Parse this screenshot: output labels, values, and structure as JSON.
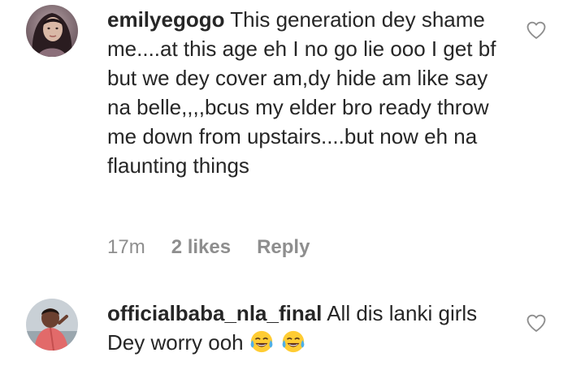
{
  "comments": [
    {
      "username": "emilyegogo",
      "text": "This generation dey shame me....at this age eh I no go lie ooo I get bf but we dey cover am,dy hide am like say na belle,,,,bcus my elder bro ready throw me down from upstairs....but now eh na flaunting things",
      "time": "17m",
      "likes": "2 likes",
      "reply_label": "Reply",
      "avatar_icon": "avatar-woman",
      "like_icon": "heart-outline-icon"
    },
    {
      "username": "officialbaba_nla_final",
      "text": "All dis lanki girls Dey worry ooh",
      "emojis": [
        "face-with-tears-of-joy",
        "face-with-tears-of-joy"
      ],
      "avatar_icon": "avatar-man",
      "like_icon": "heart-outline-icon"
    }
  ],
  "colors": {
    "text": "#262626",
    "secondary": "#8e8e8e",
    "background": "#ffffff"
  }
}
